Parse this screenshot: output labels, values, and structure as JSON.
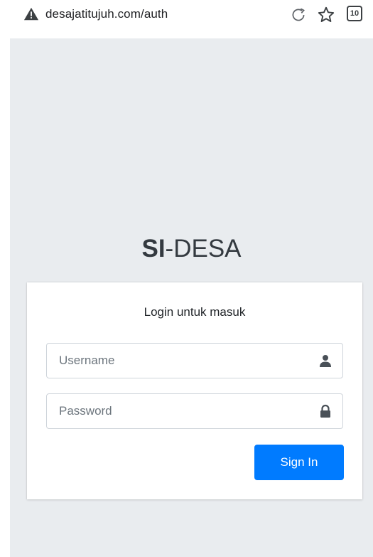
{
  "browser": {
    "url": "desajatitujuh.com/auth",
    "tab_count": "10",
    "icons": [
      "warning-icon",
      "reload-icon",
      "star-icon",
      "tabs-icon"
    ]
  },
  "login": {
    "logo_bold": "SI",
    "logo_rest": "-DESA",
    "message": "Login untuk masuk",
    "username_placeholder": "Username",
    "password_placeholder": "Password",
    "signin_label": "Sign In",
    "icons": [
      "user-icon",
      "lock-icon"
    ]
  },
  "colors": {
    "page_background": "#e9ecef",
    "primary_button": "#007bff"
  }
}
